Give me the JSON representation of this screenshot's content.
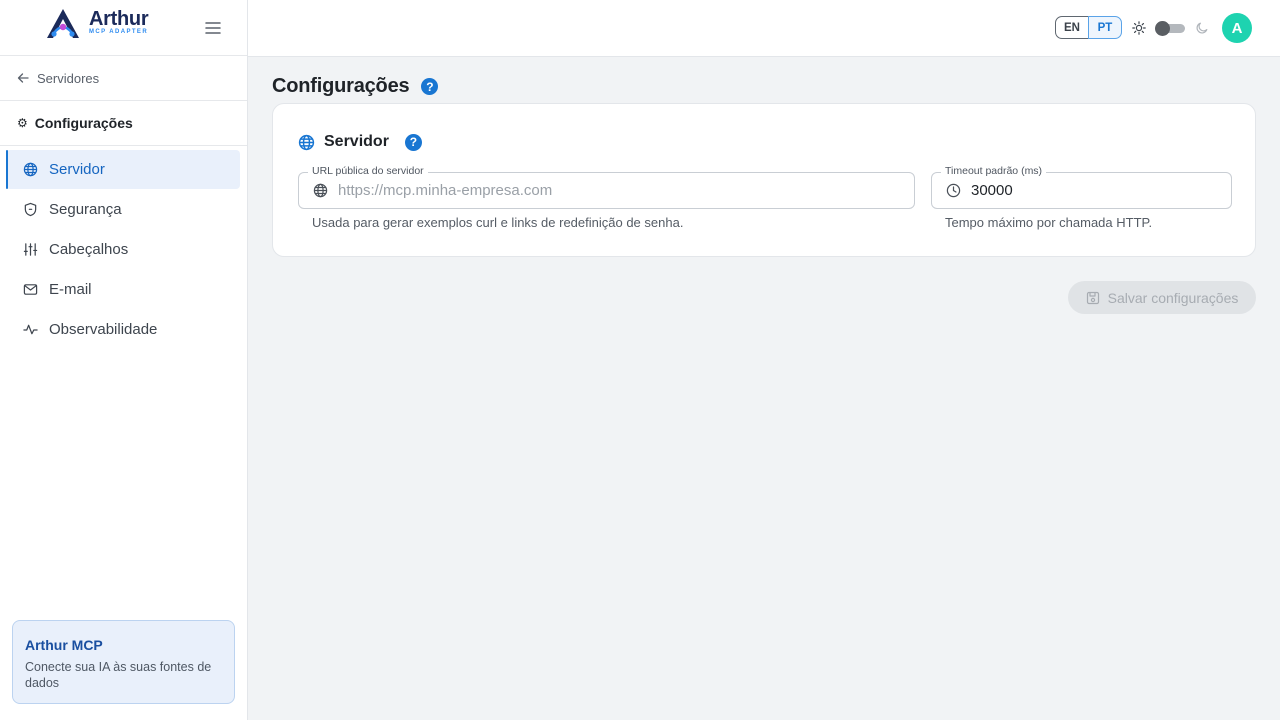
{
  "brand": {
    "name": "Arthur",
    "subtitle": "MCP ADAPTER"
  },
  "sidebar": {
    "back_label": "Servidores",
    "section_title": "Configurações",
    "items": [
      {
        "label": "Servidor",
        "icon": "globe-icon",
        "active": true
      },
      {
        "label": "Segurança",
        "icon": "shield-icon",
        "active": false
      },
      {
        "label": "Cabeçalhos",
        "icon": "sliders-icon",
        "active": false
      },
      {
        "label": "E-mail",
        "icon": "mail-icon",
        "active": false
      },
      {
        "label": "Observabilidade",
        "icon": "activity-icon",
        "active": false
      }
    ],
    "promo": {
      "title": "Arthur MCP",
      "text": "Conecte sua IA às suas fontes de dados"
    }
  },
  "header": {
    "languages": [
      "EN",
      "PT"
    ],
    "selected_language": "PT",
    "theme": "light",
    "avatar_initial": "A"
  },
  "page": {
    "title": "Configurações",
    "help_glyph": "?",
    "card": {
      "title": "Servidor",
      "url_field": {
        "label": "URL pública do servidor",
        "value": "",
        "placeholder": "https://mcp.minha-empresa.com",
        "hint": "Usada para gerar exemplos curl e links de redefinição de senha."
      },
      "timeout_field": {
        "label": "Timeout padrão (ms)",
        "value": "30000",
        "hint": "Tempo máximo por chamada HTTP."
      }
    },
    "save_label": "Salvar configurações"
  },
  "colors": {
    "accent": "#1976d2",
    "active_bg": "#e9f0fb",
    "avatar": "#1ed3b0",
    "page_bg": "#f1f3f5"
  }
}
